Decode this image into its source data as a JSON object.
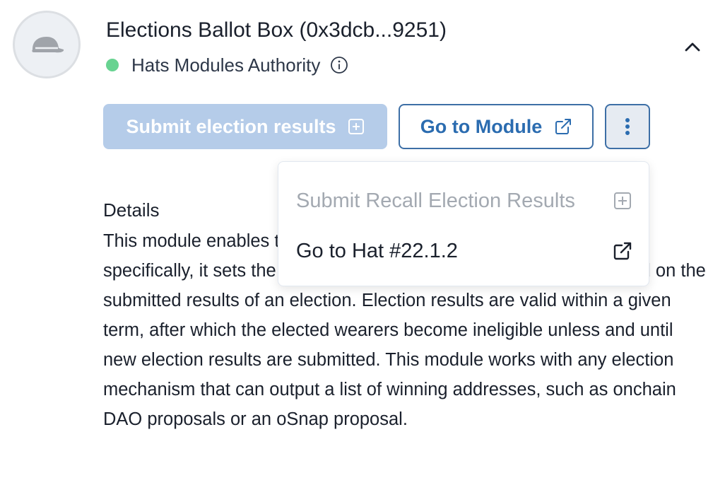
{
  "module": {
    "title": "Elections Ballot Box (0x3dcb...9251)",
    "authority": "Hats Modules Authority",
    "status_color": "#68d391"
  },
  "actions": {
    "submit_label": "Submit election results",
    "go_to_module_label": "Go to Module",
    "more_icon": "kebab-vertical-icon"
  },
  "dropdown": {
    "items": [
      {
        "label": "Submit Recall Election Results",
        "icon": "plus-square-icon",
        "disabled": true
      },
      {
        "label": "Go to Hat #22.1.2",
        "icon": "external-link-icon",
        "disabled": false
      }
    ]
  },
  "details": {
    "heading": "Details",
    "text": "This module enables the election of wearers to a given hat. More specifically, it sets the eligibility of the wearers of the given hat based on the submitted results of an election. Election results are valid within a given term, after which the elected wearers become ineligible unless and until new election results are submitted. This module works with any election mechanism that can output a list of winning addresses, such as onchain DAO proposals or an oSnap proposal."
  },
  "colors": {
    "primary": "#2b6cb0",
    "submit_disabled_bg": "#b5cce9",
    "more_button_bg": "#e6ebf2"
  }
}
